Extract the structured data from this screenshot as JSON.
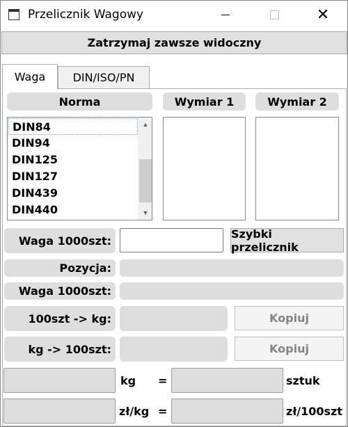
{
  "window": {
    "title": "Przelicznik Wagowy"
  },
  "titlebar": {
    "minimize": "—",
    "maximize": "□",
    "close": "✕"
  },
  "toolbar": {
    "topmost_label": "Zatrzymaj zawsze widoczny"
  },
  "tabs": [
    {
      "label": "Waga",
      "active": true
    },
    {
      "label": "DIN/ISO/PN",
      "active": false
    }
  ],
  "headers": {
    "norma": "Norma",
    "wymiar1": "Wymiar 1",
    "wymiar2": "Wymiar 2"
  },
  "norma_list": {
    "items": [
      "DIN84",
      "DIN94",
      "DIN125",
      "DIN127",
      "DIN439",
      "DIN440"
    ],
    "selected": "DIN84"
  },
  "scroll": {
    "up": "▲",
    "down": "▼"
  },
  "fields": {
    "waga_label": "Waga 1000szt:",
    "waga_value": "",
    "quick_button": "Szybki przelicznik",
    "pozycja_label": "Pozycja:",
    "waga2_label": "Waga 1000szt:",
    "kg_label": "100szt -> kg:",
    "copy1": "Kopiuj",
    "szt_label": "kg -> 100szt:",
    "copy2": "Kopiuj"
  },
  "converter": {
    "row1": {
      "unit_left": "kg",
      "eq": "=",
      "unit_right": "sztuk"
    },
    "row2": {
      "unit_left": "zł/kg",
      "eq": "=",
      "unit_right": "zł/100szt"
    }
  }
}
